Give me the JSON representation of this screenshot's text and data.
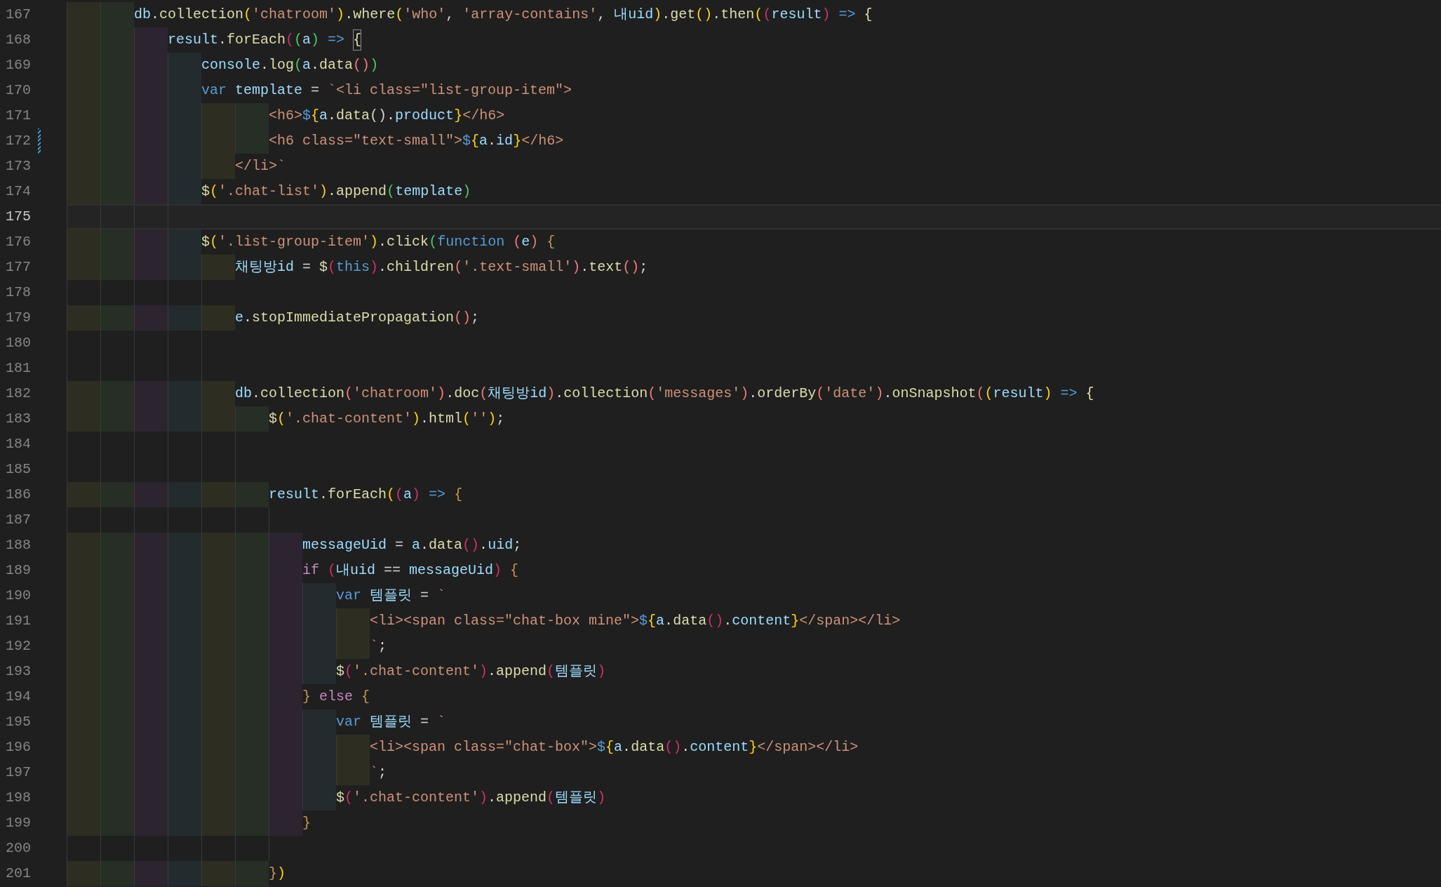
{
  "editor": {
    "lines": [
      {
        "number": "167",
        "current": false,
        "modified": false,
        "tokens": [
          {
            "kind": "var",
            "text": "db"
          },
          {
            "kind": "plain",
            "text": "."
          },
          {
            "kind": "fn",
            "text": "collection"
          },
          {
            "kind": "b1",
            "text": "("
          },
          {
            "kind": "str",
            "text": "'chatroom'"
          },
          {
            "kind": "b1",
            "text": ")"
          },
          {
            "kind": "plain",
            "text": "."
          },
          {
            "kind": "fn",
            "text": "where"
          },
          {
            "kind": "b1",
            "text": "("
          },
          {
            "kind": "str",
            "text": "'who'"
          },
          {
            "kind": "comma",
            "text": ","
          },
          {
            "kind": "str",
            "text": "'array-contains'"
          },
          {
            "kind": "comma",
            "text": ","
          },
          {
            "kind": "var",
            "text": "내uid"
          },
          {
            "kind": "b1",
            "text": ")"
          },
          {
            "kind": "plain",
            "text": "."
          },
          {
            "kind": "fn",
            "text": "get"
          },
          {
            "kind": "b1",
            "text": "()"
          },
          {
            "kind": "plain",
            "text": "."
          },
          {
            "kind": "fn",
            "text": "then"
          },
          {
            "kind": "b1",
            "text": "("
          },
          {
            "kind": "b2",
            "text": "("
          },
          {
            "kind": "var",
            "text": "result"
          },
          {
            "kind": "b2",
            "text": ")"
          },
          {
            "kind": "arrow",
            "text": "=>"
          },
          {
            "kind": "pale",
            "text": "{"
          }
        ],
        "children": [
          {
            "number": "168",
            "current": false,
            "modified": false,
            "tokens": [
              {
                "kind": "var",
                "text": "result"
              },
              {
                "kind": "plain",
                "text": "."
              },
              {
                "kind": "fn",
                "text": "forEach"
              },
              {
                "kind": "b2",
                "text": "("
              },
              {
                "kind": "b3",
                "text": "("
              },
              {
                "kind": "var",
                "text": "a"
              },
              {
                "kind": "b3",
                "text": ")"
              },
              {
                "kind": "arrow",
                "text": "=>"
              },
              {
                "kind": "match",
                "text": "{"
              }
            ],
            "children": [
              {
                "number": "169",
                "current": false,
                "modified": false,
                "tokens": [
                  {
                    "kind": "var",
                    "text": "console"
                  },
                  {
                    "kind": "plain",
                    "text": "."
                  },
                  {
                    "kind": "fn",
                    "text": "log"
                  },
                  {
                    "kind": "b3",
                    "text": "("
                  },
                  {
                    "kind": "var",
                    "text": "a"
                  },
                  {
                    "kind": "plain",
                    "text": "."
                  },
                  {
                    "kind": "fn",
                    "text": "data"
                  },
                  {
                    "kind": "b4",
                    "text": "()"
                  },
                  {
                    "kind": "b3",
                    "text": ")"
                  }
                ]
              },
              {
                "number": "170",
                "current": false,
                "modified": false,
                "tokens": [
                  {
                    "kind": "kwsp",
                    "text": "var"
                  },
                  {
                    "kind": "var",
                    "text": "template"
                  },
                  {
                    "kind": "op",
                    "text": "="
                  },
                  {
                    "kind": "str",
                    "text": "`<li class=\"list-group-item\">"
                  }
                ],
                "children": [
                  {
                    "children": [
                      {
                        "number": "171",
                        "current": false,
                        "modified": false,
                        "tokens": [
                          {
                            "kind": "str",
                            "text": "<h6>"
                          },
                          {
                            "kind": "kw",
                            "text": "$"
                          },
                          {
                            "kind": "b1",
                            "text": "{"
                          },
                          {
                            "kind": "var",
                            "text": "a"
                          },
                          {
                            "kind": "plain",
                            "text": "."
                          },
                          {
                            "kind": "fn",
                            "text": "data"
                          },
                          {
                            "kind": "plain",
                            "text": "()."
                          },
                          {
                            "kind": "var",
                            "text": "product"
                          },
                          {
                            "kind": "b1",
                            "text": "}"
                          },
                          {
                            "kind": "str",
                            "text": "</h6>"
                          }
                        ]
                      },
                      {
                        "number": "172",
                        "current": false,
                        "modified": true,
                        "tokens": [
                          {
                            "kind": "str",
                            "text": "<h6 class=\"text-small\">"
                          },
                          {
                            "kind": "kw",
                            "text": "$"
                          },
                          {
                            "kind": "b1",
                            "text": "{"
                          },
                          {
                            "kind": "var",
                            "text": "a"
                          },
                          {
                            "kind": "plain",
                            "text": "."
                          },
                          {
                            "kind": "var",
                            "text": "id"
                          },
                          {
                            "kind": "b1",
                            "text": "}"
                          },
                          {
                            "kind": "str",
                            "text": "</h6>"
                          }
                        ]
                      }
                    ]
                  },
                  {
                    "number": "173",
                    "current": false,
                    "modified": false,
                    "tokens": [
                      {
                        "kind": "str",
                        "text": "</li>`"
                      }
                    ]
                  }
                ]
              },
              {
                "number": "174",
                "current": false,
                "modified": false,
                "tokens": [
                  {
                    "kind": "fn",
                    "text": "$"
                  },
                  {
                    "kind": "b1",
                    "text": "("
                  },
                  {
                    "kind": "str",
                    "text": "'.chat-list'"
                  },
                  {
                    "kind": "b1",
                    "text": ")"
                  },
                  {
                    "kind": "plain",
                    "text": "."
                  },
                  {
                    "kind": "fn",
                    "text": "append"
                  },
                  {
                    "kind": "b3",
                    "text": "("
                  },
                  {
                    "kind": "var",
                    "text": "template"
                  },
                  {
                    "kind": "b3",
                    "text": ")"
                  }
                ]
              },
              {
                "number": "175",
                "current": true,
                "modified": false
              },
              {
                "number": "176",
                "current": false,
                "modified": false,
                "tokens": [
                  {
                    "kind": "fn",
                    "text": "$"
                  },
                  {
                    "kind": "b1",
                    "text": "("
                  },
                  {
                    "kind": "str",
                    "text": "'.list-group-item'"
                  },
                  {
                    "kind": "b1",
                    "text": ")"
                  },
                  {
                    "kind": "plain",
                    "text": "."
                  },
                  {
                    "kind": "fn",
                    "text": "click"
                  },
                  {
                    "kind": "b3",
                    "text": "("
                  },
                  {
                    "kind": "kwsp",
                    "text": "function"
                  },
                  {
                    "kind": "b4",
                    "text": "("
                  },
                  {
                    "kind": "var",
                    "text": "e"
                  },
                  {
                    "kind": "b4",
                    "text": ")"
                  },
                  {
                    "kind": "bracesp",
                    "text": "{"
                  }
                ],
                "children": [
                  {
                    "number": "177",
                    "current": false,
                    "modified": false,
                    "tokens": [
                      {
                        "kind": "var",
                        "text": "채팅방id"
                      },
                      {
                        "kind": "op",
                        "text": "="
                      },
                      {
                        "kind": "fn",
                        "text": "$"
                      },
                      {
                        "kind": "b2",
                        "text": "("
                      },
                      {
                        "kind": "kw",
                        "text": "this"
                      },
                      {
                        "kind": "b2",
                        "text": ")"
                      },
                      {
                        "kind": "plain",
                        "text": "."
                      },
                      {
                        "kind": "fn",
                        "text": "children"
                      },
                      {
                        "kind": "b4",
                        "text": "("
                      },
                      {
                        "kind": "str",
                        "text": "'.text-small'"
                      },
                      {
                        "kind": "b4",
                        "text": ")"
                      },
                      {
                        "kind": "plain",
                        "text": "."
                      },
                      {
                        "kind": "fn",
                        "text": "text"
                      },
                      {
                        "kind": "b4",
                        "text": "()"
                      },
                      {
                        "kind": "plain",
                        "text": ";"
                      }
                    ]
                  },
                  {
                    "number": "178",
                    "current": false,
                    "modified": false
                  },
                  {
                    "number": "179",
                    "current": false,
                    "modified": false,
                    "tokens": [
                      {
                        "kind": "var",
                        "text": "e"
                      },
                      {
                        "kind": "plain",
                        "text": "."
                      },
                      {
                        "kind": "fn",
                        "text": "stopImmediatePropagation"
                      },
                      {
                        "kind": "b4",
                        "text": "()"
                      },
                      {
                        "kind": "plain",
                        "text": ";"
                      }
                    ]
                  },
                  {
                    "number": "180",
                    "current": false,
                    "modified": false
                  },
                  {
                    "number": "181",
                    "current": false,
                    "modified": false
                  },
                  {
                    "number": "182",
                    "current": false,
                    "modified": false,
                    "tokens": [
                      {
                        "kind": "var",
                        "text": "db"
                      },
                      {
                        "kind": "plain",
                        "text": "."
                      },
                      {
                        "kind": "fn",
                        "text": "collection"
                      },
                      {
                        "kind": "b4",
                        "text": "("
                      },
                      {
                        "kind": "str",
                        "text": "'chatroom'"
                      },
                      {
                        "kind": "b4",
                        "text": ")"
                      },
                      {
                        "kind": "plain",
                        "text": "."
                      },
                      {
                        "kind": "fn",
                        "text": "doc"
                      },
                      {
                        "kind": "b4",
                        "text": "("
                      },
                      {
                        "kind": "var",
                        "text": "채팅방id"
                      },
                      {
                        "kind": "b4",
                        "text": ")"
                      },
                      {
                        "kind": "plain",
                        "text": "."
                      },
                      {
                        "kind": "fn",
                        "text": "collection"
                      },
                      {
                        "kind": "b4",
                        "text": "("
                      },
                      {
                        "kind": "str",
                        "text": "'messages'"
                      },
                      {
                        "kind": "b4",
                        "text": ")"
                      },
                      {
                        "kind": "plain",
                        "text": "."
                      },
                      {
                        "kind": "fn",
                        "text": "orderBy"
                      },
                      {
                        "kind": "b4",
                        "text": "("
                      },
                      {
                        "kind": "str",
                        "text": "'date'"
                      },
                      {
                        "kind": "b4",
                        "text": ")"
                      },
                      {
                        "kind": "plain",
                        "text": "."
                      },
                      {
                        "kind": "fn",
                        "text": "onSnapshot"
                      },
                      {
                        "kind": "b4",
                        "text": "("
                      },
                      {
                        "kind": "b1",
                        "text": "("
                      },
                      {
                        "kind": "var",
                        "text": "result"
                      },
                      {
                        "kind": "b1",
                        "text": ")"
                      },
                      {
                        "kind": "arrow",
                        "text": "=>"
                      },
                      {
                        "kind": "pale",
                        "text": "{"
                      }
                    ],
                    "children": [
                      {
                        "number": "183",
                        "current": false,
                        "modified": false,
                        "tokens": [
                          {
                            "kind": "fn",
                            "text": "$"
                          },
                          {
                            "kind": "b1",
                            "text": "("
                          },
                          {
                            "kind": "str",
                            "text": "'.chat-content'"
                          },
                          {
                            "kind": "b1",
                            "text": ")"
                          },
                          {
                            "kind": "plain",
                            "text": "."
                          },
                          {
                            "kind": "fn",
                            "text": "html"
                          },
                          {
                            "kind": "b1",
                            "text": "("
                          },
                          {
                            "kind": "str",
                            "text": "''"
                          },
                          {
                            "kind": "b1",
                            "text": ")"
                          },
                          {
                            "kind": "plain",
                            "text": ";"
                          }
                        ]
                      },
                      {
                        "number": "184",
                        "current": false,
                        "modified": false
                      },
                      {
                        "number": "185",
                        "current": false,
                        "modified": false
                      },
                      {
                        "number": "186",
                        "current": false,
                        "modified": false,
                        "tokens": [
                          {
                            "kind": "var",
                            "text": "result"
                          },
                          {
                            "kind": "plain",
                            "text": "."
                          },
                          {
                            "kind": "fn",
                            "text": "forEach"
                          },
                          {
                            "kind": "b1",
                            "text": "("
                          },
                          {
                            "kind": "b2",
                            "text": "("
                          },
                          {
                            "kind": "var",
                            "text": "a"
                          },
                          {
                            "kind": "b2",
                            "text": ")"
                          },
                          {
                            "kind": "arrow",
                            "text": "=>"
                          },
                          {
                            "kind": "brace",
                            "text": "{"
                          }
                        ],
                        "children": [
                          {
                            "number": "187",
                            "current": false,
                            "modified": false
                          },
                          {
                            "number": "188",
                            "current": false,
                            "modified": false,
                            "tokens": [
                              {
                                "kind": "var",
                                "text": "messageUid"
                              },
                              {
                                "kind": "op",
                                "text": "="
                              },
                              {
                                "kind": "var",
                                "text": "a"
                              },
                              {
                                "kind": "plain",
                                "text": "."
                              },
                              {
                                "kind": "fn",
                                "text": "data"
                              },
                              {
                                "kind": "b2",
                                "text": "()"
                              },
                              {
                                "kind": "plain",
                                "text": "."
                              },
                              {
                                "kind": "var",
                                "text": "uid"
                              },
                              {
                                "kind": "plain",
                                "text": ";"
                              }
                            ]
                          },
                          {
                            "number": "189",
                            "current": false,
                            "modified": false,
                            "tokens": [
                              {
                                "kind": "ctrlsp",
                                "text": "if"
                              },
                              {
                                "kind": "b2",
                                "text": "("
                              },
                              {
                                "kind": "var",
                                "text": "내uid"
                              },
                              {
                                "kind": "op",
                                "text": "=="
                              },
                              {
                                "kind": "var",
                                "text": "messageUid"
                              },
                              {
                                "kind": "b2",
                                "text": ")"
                              },
                              {
                                "kind": "bracesp",
                                "text": "{"
                              }
                            ],
                            "children": [
                              {
                                "number": "190",
                                "current": false,
                                "modified": false,
                                "tokens": [
                                  {
                                    "kind": "kwsp",
                                    "text": "var"
                                  },
                                  {
                                    "kind": "var",
                                    "text": "템플릿"
                                  },
                                  {
                                    "kind": "op",
                                    "text": "="
                                  },
                                  {
                                    "kind": "str",
                                    "text": "`"
                                  }
                                ],
                                "children": [
                                  {
                                    "number": "191",
                                    "current": false,
                                    "modified": false,
                                    "tokens": [
                                      {
                                        "kind": "str",
                                        "text": "<li><span class=\"chat-box mine\">"
                                      },
                                      {
                                        "kind": "kw",
                                        "text": "$"
                                      },
                                      {
                                        "kind": "b1",
                                        "text": "{"
                                      },
                                      {
                                        "kind": "var",
                                        "text": "a"
                                      },
                                      {
                                        "kind": "plain",
                                        "text": "."
                                      },
                                      {
                                        "kind": "fn",
                                        "text": "data"
                                      },
                                      {
                                        "kind": "b2",
                                        "text": "()"
                                      },
                                      {
                                        "kind": "plain",
                                        "text": "."
                                      },
                                      {
                                        "kind": "var",
                                        "text": "content"
                                      },
                                      {
                                        "kind": "b1",
                                        "text": "}"
                                      },
                                      {
                                        "kind": "str",
                                        "text": "</span></li>"
                                      }
                                    ]
                                  },
                                  {
                                    "number": "192",
                                    "current": false,
                                    "modified": false,
                                    "tokens": [
                                      {
                                        "kind": "str",
                                        "text": "`"
                                      },
                                      {
                                        "kind": "plain",
                                        "text": ";"
                                      }
                                    ]
                                  }
                                ]
                              },
                              {
                                "number": "193",
                                "current": false,
                                "modified": false,
                                "tokens": [
                                  {
                                    "kind": "fn",
                                    "text": "$"
                                  },
                                  {
                                    "kind": "b2",
                                    "text": "("
                                  },
                                  {
                                    "kind": "str",
                                    "text": "'.chat-content'"
                                  },
                                  {
                                    "kind": "b2",
                                    "text": ")"
                                  },
                                  {
                                    "kind": "plain",
                                    "text": "."
                                  },
                                  {
                                    "kind": "fn",
                                    "text": "append"
                                  },
                                  {
                                    "kind": "b2",
                                    "text": "("
                                  },
                                  {
                                    "kind": "var",
                                    "text": "템플릿"
                                  },
                                  {
                                    "kind": "b2",
                                    "text": ")"
                                  }
                                ]
                              }
                            ]
                          },
                          {
                            "number": "194",
                            "current": false,
                            "modified": false,
                            "tokens": [
                              {
                                "kind": "brace",
                                "text": "}"
                              },
                              {
                                "kind": "ctrlpad",
                                "text": "else"
                              },
                              {
                                "kind": "brace",
                                "text": "{"
                              }
                            ],
                            "children": [
                              {
                                "number": "195",
                                "current": false,
                                "modified": false,
                                "tokens": [
                                  {
                                    "kind": "kwsp",
                                    "text": "var"
                                  },
                                  {
                                    "kind": "var",
                                    "text": "템플릿"
                                  },
                                  {
                                    "kind": "op",
                                    "text": "="
                                  },
                                  {
                                    "kind": "str",
                                    "text": "`"
                                  }
                                ],
                                "children": [
                                  {
                                    "number": "196",
                                    "current": false,
                                    "modified": false,
                                    "tokens": [
                                      {
                                        "kind": "str",
                                        "text": "<li><span class=\"chat-box\">"
                                      },
                                      {
                                        "kind": "kw",
                                        "text": "$"
                                      },
                                      {
                                        "kind": "b1",
                                        "text": "{"
                                      },
                                      {
                                        "kind": "var",
                                        "text": "a"
                                      },
                                      {
                                        "kind": "plain",
                                        "text": "."
                                      },
                                      {
                                        "kind": "fn",
                                        "text": "data"
                                      },
                                      {
                                        "kind": "b2",
                                        "text": "()"
                                      },
                                      {
                                        "kind": "plain",
                                        "text": "."
                                      },
                                      {
                                        "kind": "var",
                                        "text": "content"
                                      },
                                      {
                                        "kind": "b1",
                                        "text": "}"
                                      },
                                      {
                                        "kind": "str",
                                        "text": "</span></li>"
                                      }
                                    ]
                                  },
                                  {
                                    "number": "197",
                                    "current": false,
                                    "modified": false,
                                    "tokens": [
                                      {
                                        "kind": "str",
                                        "text": "`"
                                      },
                                      {
                                        "kind": "plain",
                                        "text": ";"
                                      }
                                    ]
                                  }
                                ]
                              },
                              {
                                "number": "198",
                                "current": false,
                                "modified": false,
                                "tokens": [
                                  {
                                    "kind": "fn",
                                    "text": "$"
                                  },
                                  {
                                    "kind": "b2",
                                    "text": "("
                                  },
                                  {
                                    "kind": "str",
                                    "text": "'.chat-content'"
                                  },
                                  {
                                    "kind": "b2",
                                    "text": ")"
                                  },
                                  {
                                    "kind": "plain",
                                    "text": "."
                                  },
                                  {
                                    "kind": "fn",
                                    "text": "append"
                                  },
                                  {
                                    "kind": "b2",
                                    "text": "("
                                  },
                                  {
                                    "kind": "var",
                                    "text": "템플릿"
                                  },
                                  {
                                    "kind": "b2",
                                    "text": ")"
                                  }
                                ]
                              }
                            ]
                          },
                          {
                            "number": "199",
                            "current": false,
                            "modified": false,
                            "tokens": [
                              {
                                "kind": "brace",
                                "text": "}"
                              }
                            ]
                          }
                        ]
                      },
                      {
                        "number": "200",
                        "current": false,
                        "modified": false
                      },
                      {
                        "number": "201",
                        "current": false,
                        "modified": false,
                        "tokens": [
                          {
                            "kind": "brace",
                            "text": "}"
                          },
                          {
                            "kind": "b1",
                            "text": ")"
                          }
                        ]
                      }
                    ]
                  }
                ]
              }
            ]
          }
        ]
      }
    ]
  }
}
